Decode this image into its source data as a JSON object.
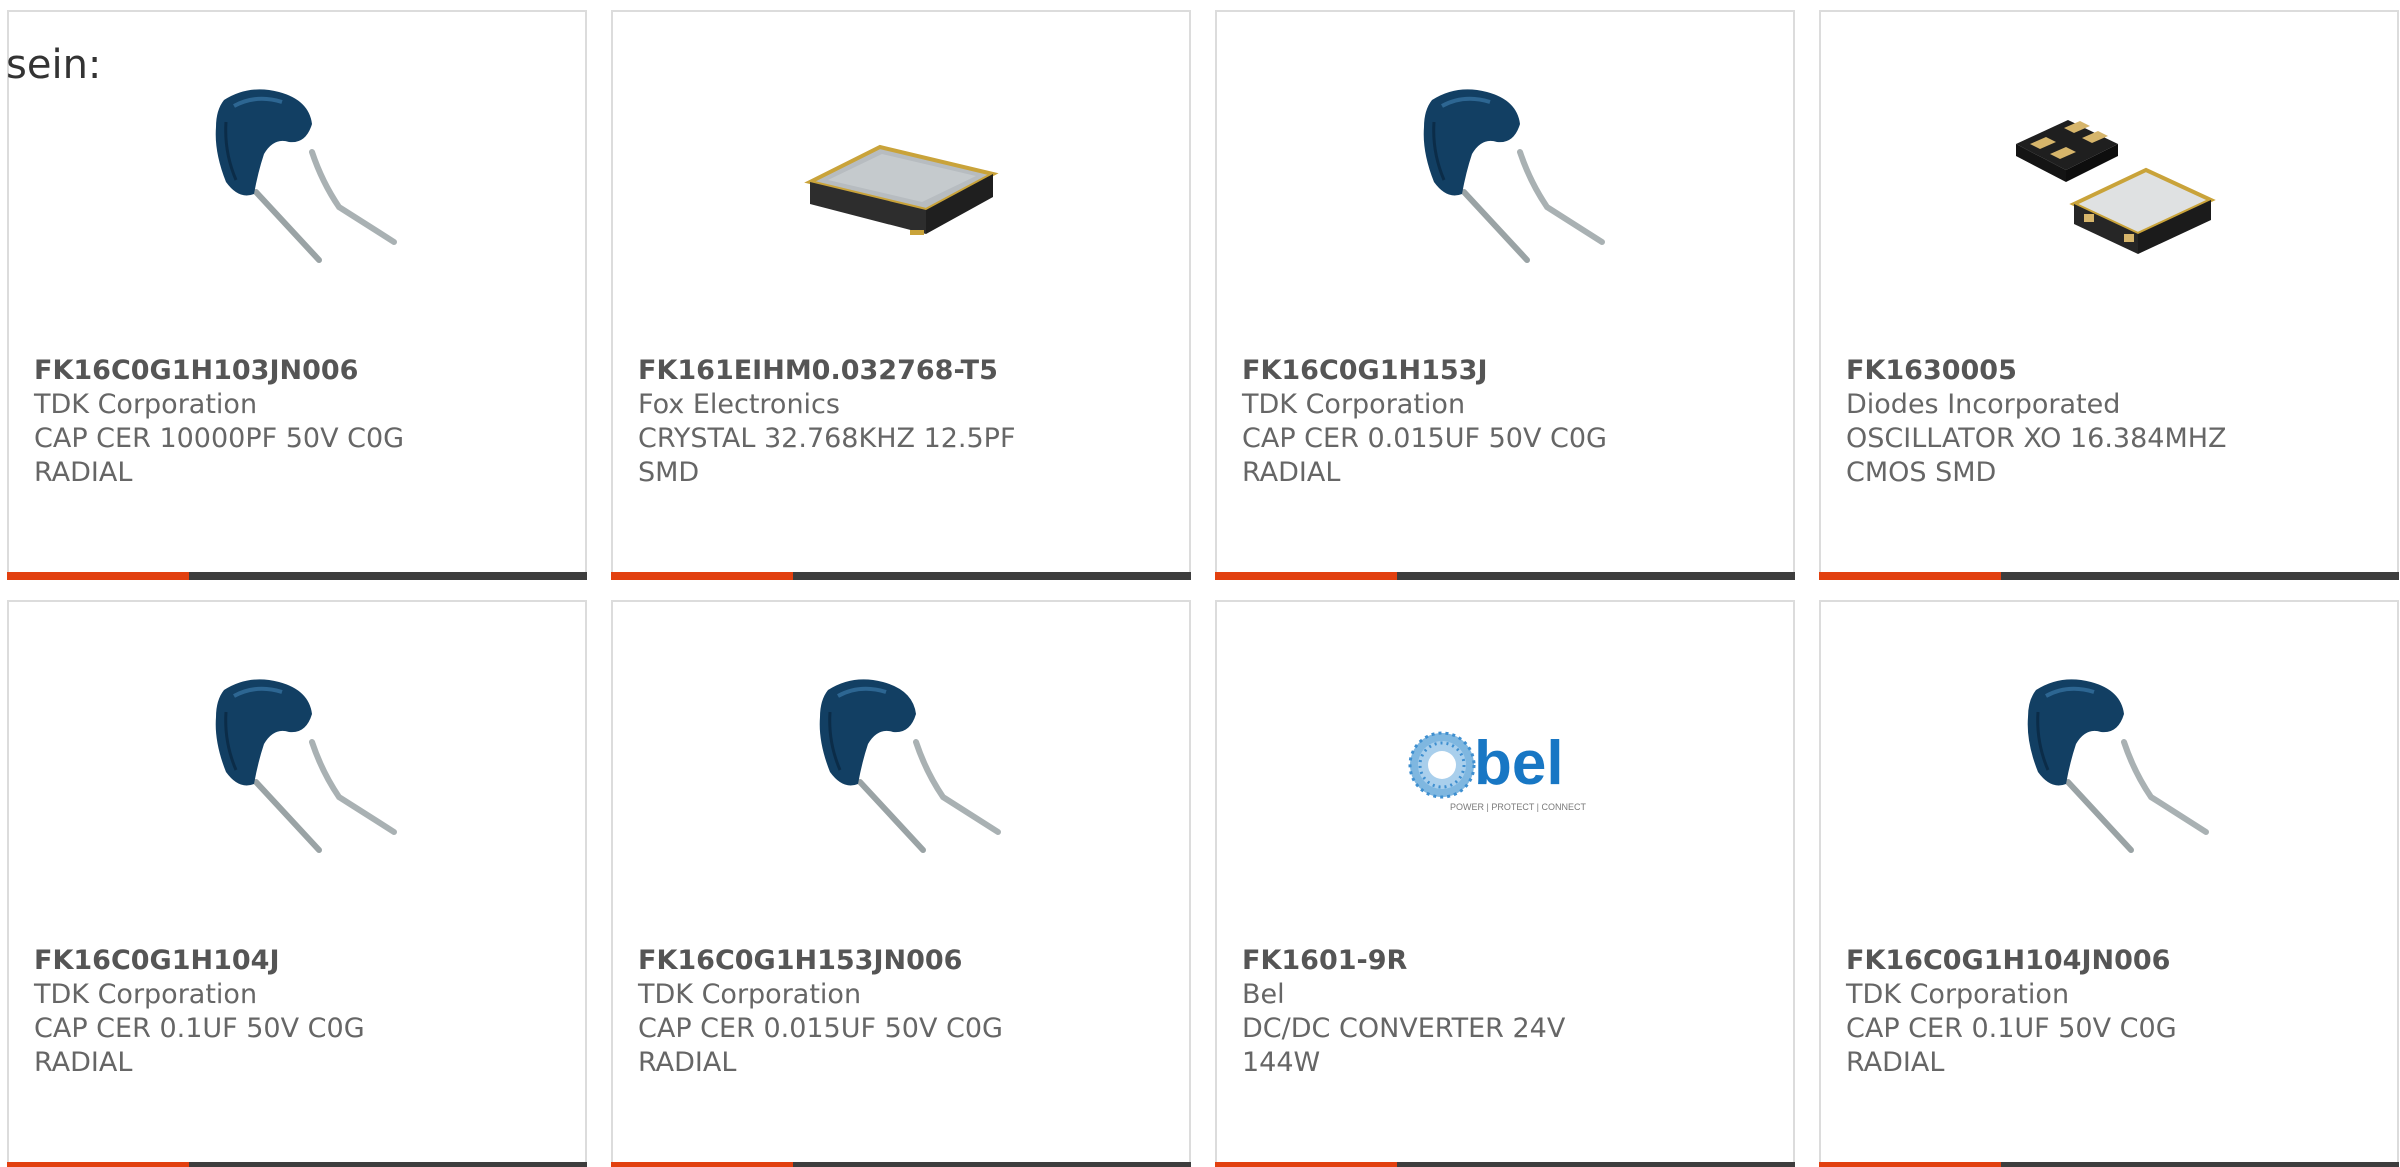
{
  "intro_text": "sein:",
  "colors": {
    "accent": "#e2400f",
    "bar": "#3d3d3d",
    "border": "#dcdcdc",
    "text": "#666666"
  },
  "products": [
    {
      "part": "FK16C0G1H103JN006",
      "maker": "TDK Corporation",
      "desc": "CAP CER 10000PF 50V C0G RADIAL",
      "image": "radial-capacitor"
    },
    {
      "part": "FK161EIHM0.032768-T5",
      "maker": "Fox Electronics",
      "desc": "CRYSTAL 32.768KHZ 12.5PF SMD",
      "image": "smd-crystal"
    },
    {
      "part": "FK16C0G1H153J",
      "maker": "TDK Corporation",
      "desc": "CAP CER 0.015UF 50V C0G RADIAL",
      "image": "radial-capacitor"
    },
    {
      "part": "FK1630005",
      "maker": "Diodes Incorporated",
      "desc": "OSCILLATOR XO 16.384MHZ CMOS SMD",
      "image": "smd-oscillator"
    },
    {
      "part": "FK16C0G1H104J",
      "maker": "TDK Corporation",
      "desc": "CAP CER 0.1UF 50V C0G RADIAL",
      "image": "radial-capacitor"
    },
    {
      "part": "FK16C0G1H153JN006",
      "maker": "TDK Corporation",
      "desc": "CAP CER 0.015UF 50V C0G RADIAL",
      "image": "radial-capacitor"
    },
    {
      "part": "FK1601-9R",
      "maker": "Bel",
      "desc": "DC/DC CONVERTER 24V 144W",
      "image": "bel-logo",
      "logo_text": "bel",
      "logo_tagline": "POWER | PROTECT | CONNECT"
    },
    {
      "part": "FK16C0G1H104JN006",
      "maker": "TDK Corporation",
      "desc": "CAP CER 0.1UF 50V C0G RADIAL",
      "image": "radial-capacitor"
    }
  ]
}
